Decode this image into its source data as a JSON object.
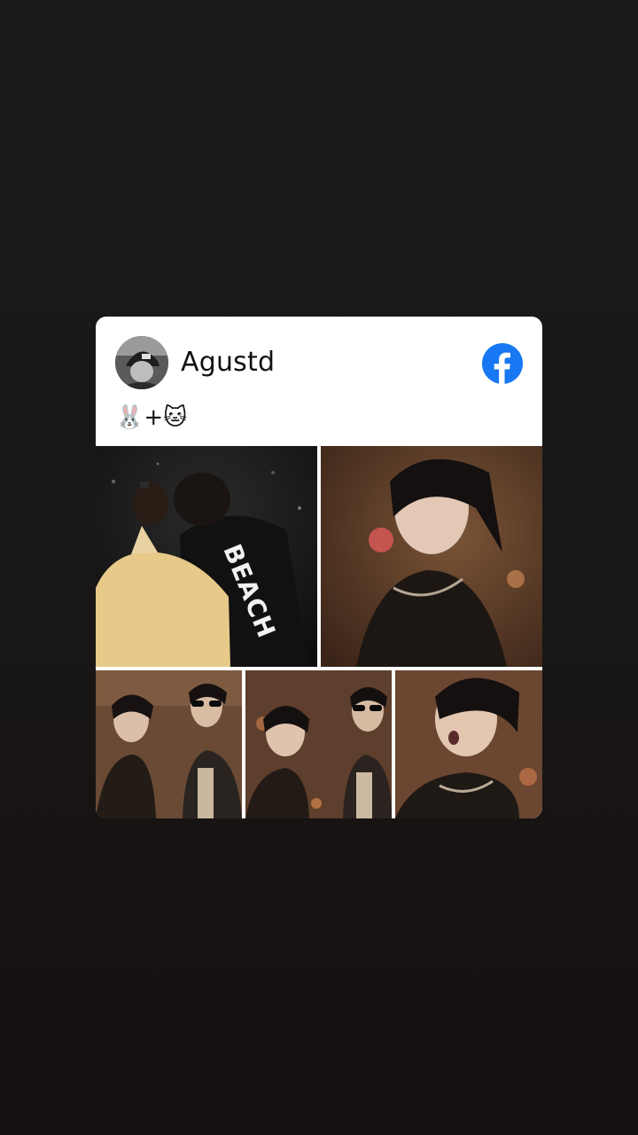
{
  "post": {
    "author_name": "Agustd",
    "caption": "🐰+🐱",
    "platform_icon": "facebook-icon",
    "brand_color": "#1877F2"
  },
  "photos": [
    {
      "id": "photo-1",
      "printed_text": "BEACH"
    },
    {
      "id": "photo-2"
    },
    {
      "id": "photo-3"
    },
    {
      "id": "photo-4"
    },
    {
      "id": "photo-5"
    }
  ]
}
